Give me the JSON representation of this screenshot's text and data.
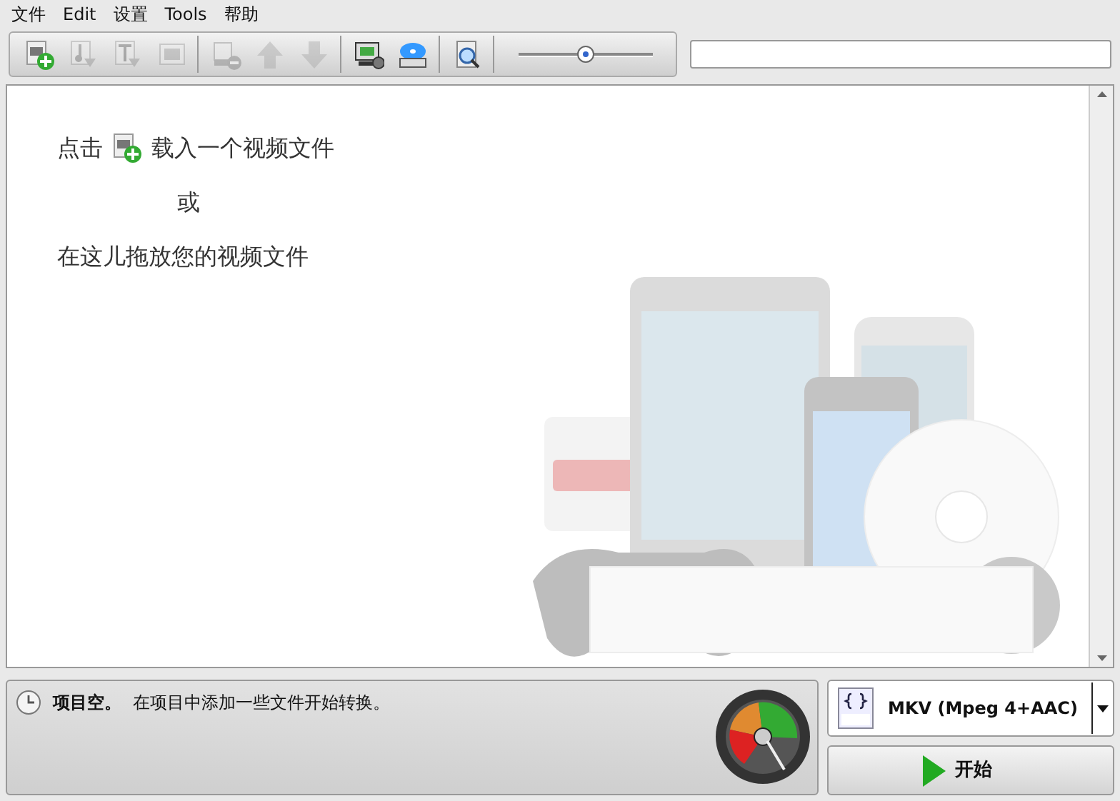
{
  "menu": [
    {
      "label": "文件"
    },
    {
      "label": "Edit"
    },
    {
      "label": "设置"
    },
    {
      "label": "Tools"
    },
    {
      "label": "帮助"
    }
  ],
  "toolbar": {
    "groups": [
      [
        {
          "kind": "add-video",
          "disabled": false
        },
        {
          "kind": "add-audio",
          "disabled": true
        },
        {
          "kind": "add-text",
          "disabled": true
        },
        {
          "kind": "picture",
          "disabled": true
        }
      ],
      [
        {
          "kind": "remove",
          "disabled": true
        },
        {
          "kind": "up",
          "disabled": true
        },
        {
          "kind": "down",
          "disabled": true
        }
      ],
      [
        {
          "kind": "monitor-gear",
          "disabled": false
        },
        {
          "kind": "disc",
          "disabled": false
        }
      ],
      [
        {
          "kind": "preview",
          "disabled": false
        }
      ]
    ],
    "slider": {
      "level": 0.5
    }
  },
  "drop_area": {
    "line_1_before": "点击",
    "line_1_after": "载入一个视频文件",
    "line_2": "或",
    "line_3": "在这儿拖放您的视频文件"
  },
  "status": {
    "title": "项目空。",
    "message": "在项目中添加一些文件开始转换。"
  },
  "format": {
    "label": "MKV (Mpeg 4+AAC)"
  },
  "start_button": {
    "label": "开始"
  }
}
